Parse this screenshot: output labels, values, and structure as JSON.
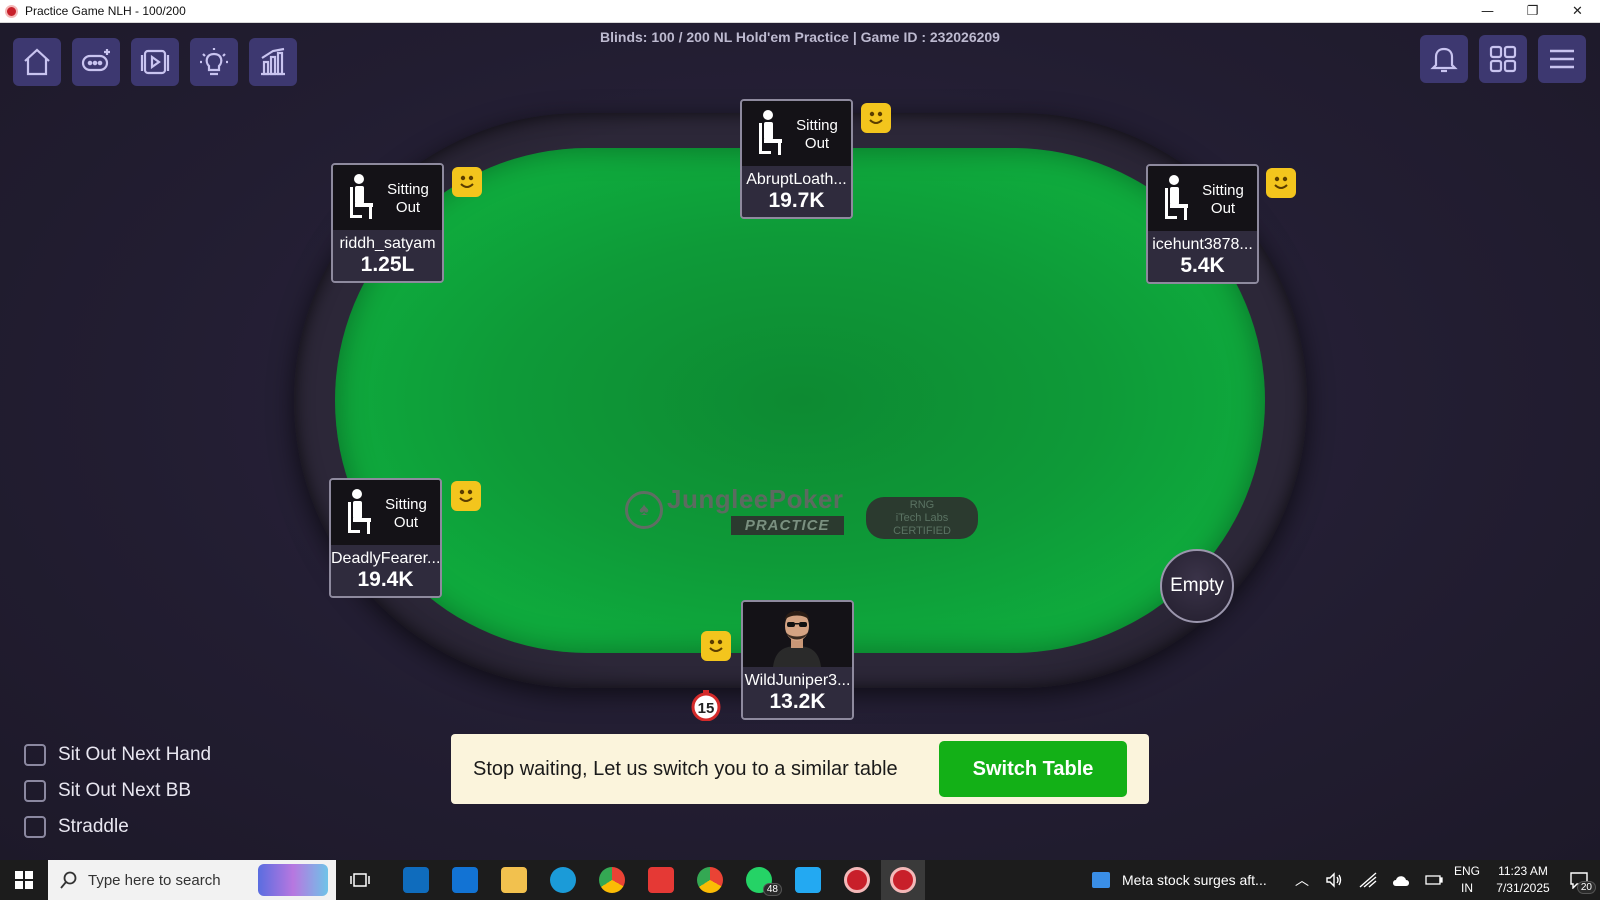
{
  "window": {
    "title": "Practice Game NLH - 100/200",
    "minimize": "—",
    "restore": "❐",
    "close": "✕"
  },
  "game_info": "Blinds: 100 / 200  NL Hold'em Practice | Game ID : 232026209",
  "table_logo": {
    "brand": "JungleePoker",
    "mode": "PRACTICE",
    "cert_line1": "RNG",
    "cert_line2": "iTech Labs",
    "cert_line3": "CERTIFIED"
  },
  "seats": [
    {
      "name": "AbruptLoath...",
      "stack": "19.7K",
      "status": "Sitting Out"
    },
    {
      "name": "riddh_satyam",
      "stack": "1.25L",
      "status": "Sitting Out"
    },
    {
      "name": "icehunt3878...",
      "stack": "5.4K",
      "status": "Sitting Out"
    },
    {
      "name": "DeadlyFearer...",
      "stack": "19.4K",
      "status": "Sitting Out"
    },
    {
      "name": "WildJuniper3...",
      "stack": "13.2K",
      "status": ""
    }
  ],
  "empty_seat_label": "Empty",
  "timer_value": "15",
  "options": {
    "sit_out_next_hand": "Sit Out Next Hand",
    "sit_out_next_bb": "Sit Out Next BB",
    "straddle": "Straddle"
  },
  "switch_banner": {
    "message": "Stop waiting, Let us switch you to a similar table",
    "button": "Switch Table"
  },
  "taskbar": {
    "search_placeholder": "Type here to search",
    "whatsapp_badge": "48",
    "news": "Meta stock surges aft...",
    "lang_top": "ENG",
    "lang_bottom": "IN",
    "time": "11:23 AM",
    "date": "7/31/2025",
    "notifications": "20"
  },
  "colors": {
    "felt": "#0fae3e",
    "tool_button": "#3d3870",
    "switch_button": "#13b017",
    "banner": "#fbf4dc",
    "emoji": "#f3c51d"
  }
}
